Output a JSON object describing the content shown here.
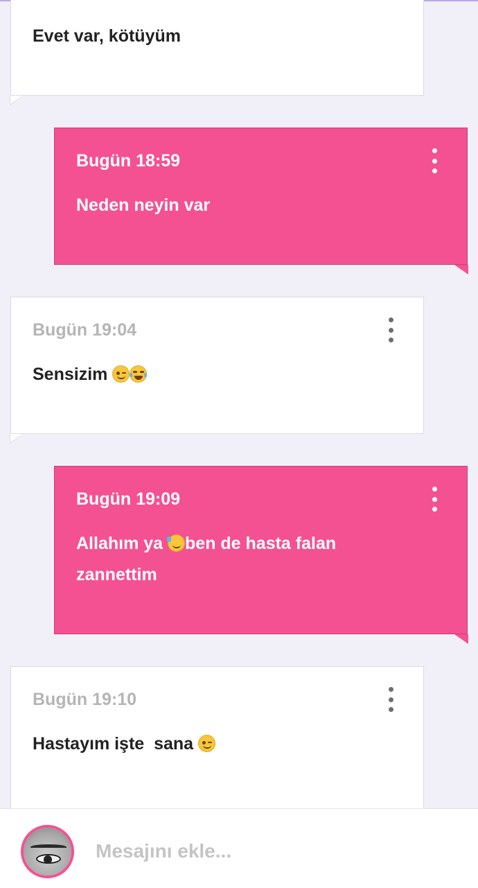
{
  "messages": [
    {
      "direction": "incoming",
      "time": "",
      "text": "Evet var, kötüyüm"
    },
    {
      "direction": "outgoing",
      "time": "Bugün 18:59",
      "text": "Neden neyin var"
    },
    {
      "direction": "incoming",
      "time": "Bugün 19:04",
      "text": "Sensizim",
      "emojis": [
        "winking-face-emoji",
        "laughing-tears-emoji"
      ]
    },
    {
      "direction": "outgoing",
      "time": "Bugün 19:09",
      "text_before": "Allahım ya",
      "text_after": "ben de hasta falan zannettim",
      "emojis": [
        "sweat-smile-emoji"
      ]
    },
    {
      "direction": "incoming",
      "time": "Bugün 19:10",
      "text": "Hastayım işte  sana",
      "emojis": [
        "winking-face-emoji"
      ]
    }
  ],
  "composer": {
    "placeholder": "Mesajını ekle..."
  },
  "icons": {
    "more_menu": "more-vertical-icon"
  },
  "colors": {
    "outgoing_bubble": "#f45192",
    "incoming_bubble": "#ffffff",
    "background": "#f1f0f9",
    "timestamp_incoming": "#b5b5b5"
  }
}
